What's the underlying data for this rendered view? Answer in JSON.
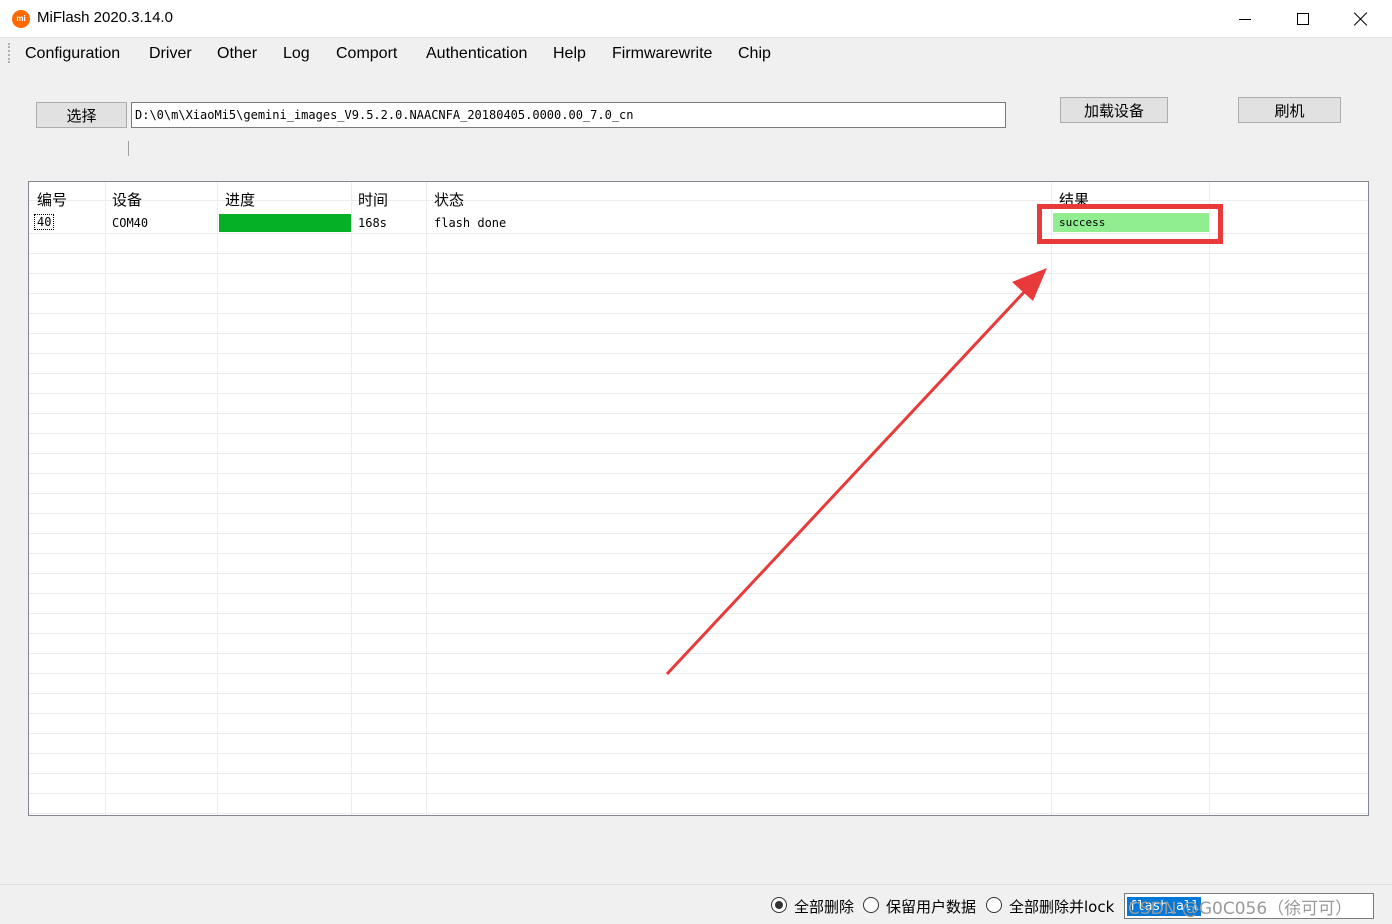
{
  "window": {
    "app_icon_text": "mi",
    "title": "MiFlash 2020.3.14.0"
  },
  "menu": [
    "Configuration",
    "Driver",
    "Other",
    "Log",
    "Comport",
    "Authentication",
    "Help",
    "Firmwarewrite",
    "Chip"
  ],
  "toolbar": {
    "select_label": "选择",
    "path_value": "D:\\0\\m\\XiaoMi5\\gemini_images_V9.5.2.0.NAACNFA_20180405.0000.00_7.0_cn",
    "load_device_label": "加载设备",
    "flash_label": "刷机"
  },
  "table": {
    "columns": [
      "编号",
      "设备",
      "进度",
      "时间",
      "状态",
      "结果"
    ],
    "rows": [
      {
        "num": "40",
        "device": "COM40",
        "progress_percent": 100,
        "time": "168s",
        "status": "flash done",
        "result": "success"
      }
    ]
  },
  "status_bar": {
    "options": [
      "全部删除",
      "保留用户数据",
      "全部删除并lock"
    ],
    "selected_option": "全部删除",
    "field_text": "flash_all",
    "watermark": "CSDN @G0C056（徐可可）"
  },
  "colors": {
    "progress_fill": "#06b025",
    "result_success": "#90ee90",
    "annotation": "#e83a3a"
  }
}
